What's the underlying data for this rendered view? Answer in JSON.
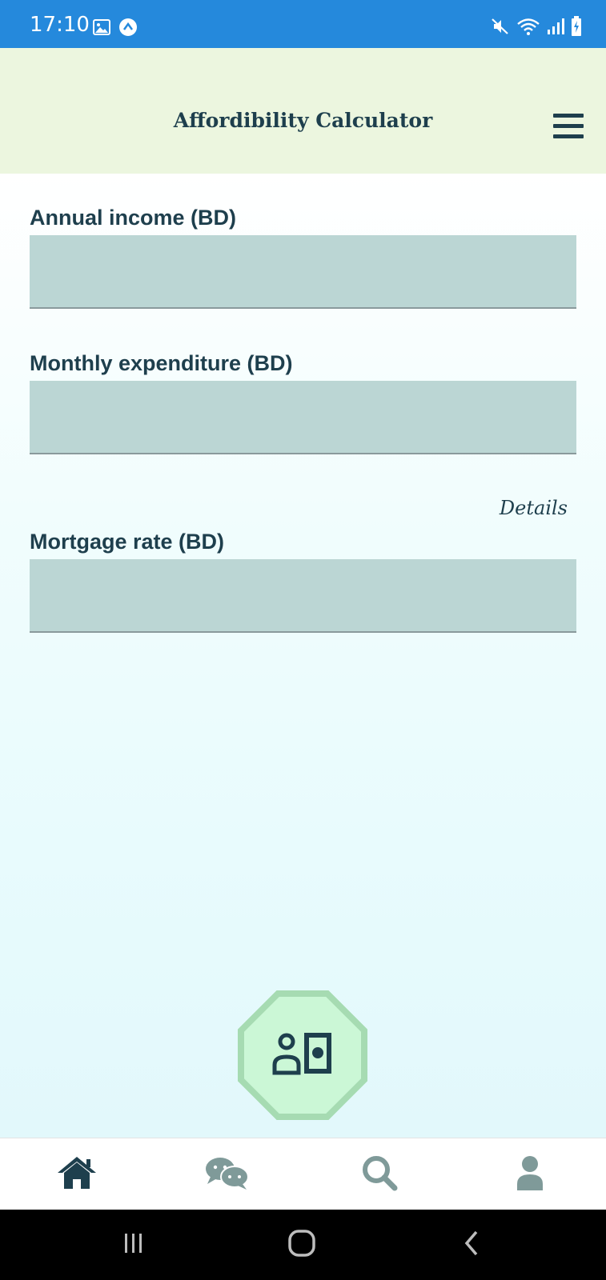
{
  "status_bar": {
    "time": "17:10",
    "icons_left": [
      "gallery-icon",
      "app-notification-icon"
    ],
    "icons_right": [
      "mute-icon",
      "wifi-icon",
      "signal-icon",
      "battery-charging-icon"
    ],
    "background": "#2589dc"
  },
  "header": {
    "title": "Affordibility Calculator",
    "background": "#ecf6df",
    "menu_icon": "hamburger-menu-icon"
  },
  "form": {
    "fields": [
      {
        "label": "Annual income (BD)",
        "value": ""
      },
      {
        "label": "Monthly expenditure (BD)",
        "value": ""
      },
      {
        "label": "Mortgage rate (BD)",
        "value": ""
      }
    ],
    "details_link": "Details",
    "input_background": "#bbd6d4"
  },
  "fab": {
    "icon": "person-money-icon",
    "background": "#cbf7d6"
  },
  "bottom_nav": {
    "items": [
      {
        "icon": "home-icon",
        "active": true
      },
      {
        "icon": "chat-icon",
        "active": false
      },
      {
        "icon": "search-icon",
        "active": false
      },
      {
        "icon": "profile-icon",
        "active": false
      }
    ],
    "active_color": "#1e3f4d",
    "inactive_color": "#7f9a99"
  },
  "system_nav": {
    "buttons": [
      "recent-apps-icon",
      "home-button-icon",
      "back-icon"
    ]
  }
}
